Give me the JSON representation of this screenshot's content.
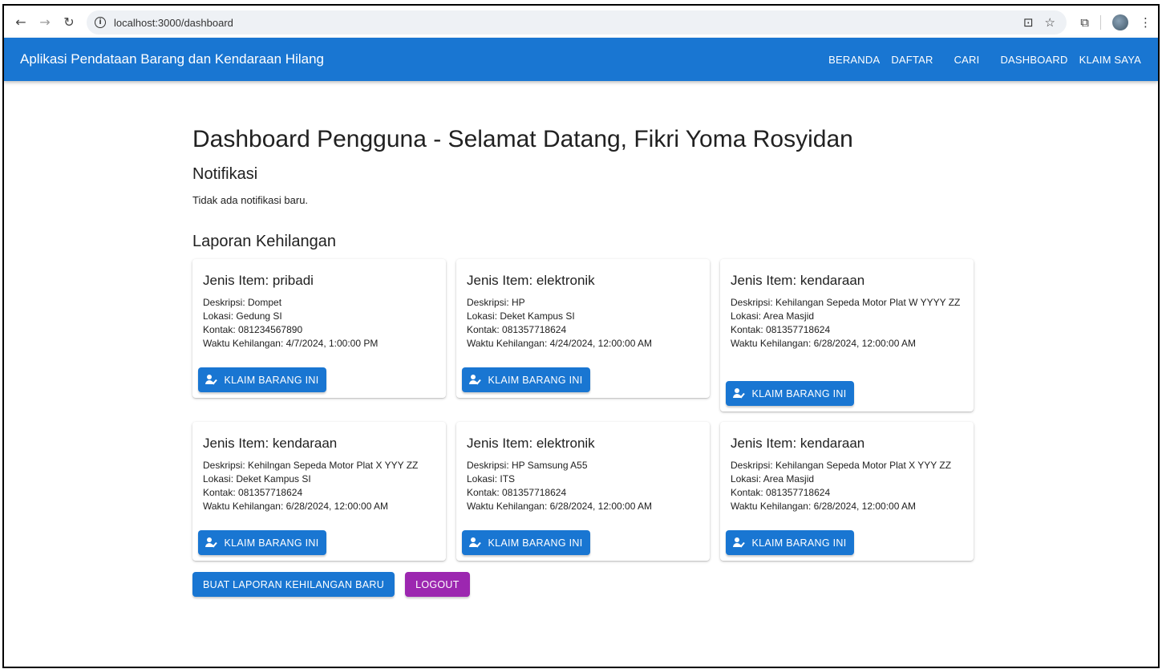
{
  "browser": {
    "url": "localhost:3000/dashboard",
    "back_icon": "←",
    "forward_icon": "→",
    "reload_icon": "↻",
    "info_icon": "i",
    "install_icon": "⊡",
    "star_icon": "☆",
    "extensions_icon": "⧉",
    "menu_icon": "⋮"
  },
  "appbar": {
    "title": "Aplikasi Pendataan Barang dan Kendaraan Hilang",
    "nav": [
      "BERANDA",
      "DAFTAR",
      "CARI",
      "DASHBOARD",
      "KLAIM SAYA"
    ],
    "color": "#1976d2"
  },
  "main": {
    "heading": "Dashboard Pengguna - Selamat Datang, Fikri Yoma Rosyidan",
    "notif_heading": "Notifikasi",
    "notif_text": "Tidak ada notifikasi baru.",
    "reports_heading": "Laporan Kehilangan",
    "claim_label": "KLAIM BARANG INI",
    "reports": [
      {
        "title": "Jenis Item: pribadi",
        "desc": "Deskripsi: Dompet",
        "loc": "Lokasi: Gedung SI",
        "contact": "Kontak: 081234567890",
        "time": "Waktu Kehilangan: 4/7/2024, 1:00:00 PM"
      },
      {
        "title": "Jenis Item: elektronik",
        "desc": "Deskripsi: HP",
        "loc": "Lokasi: Deket Kampus SI",
        "contact": "Kontak: 081357718624",
        "time": "Waktu Kehilangan: 4/24/2024, 12:00:00 AM"
      },
      {
        "title": "Jenis Item: kendaraan",
        "desc": "Deskripsi: Kehilangan Sepeda Motor Plat W YYYY ZZ",
        "loc": "Lokasi: Area Masjid",
        "contact": "Kontak: 081357718624",
        "time": "Waktu Kehilangan: 6/28/2024, 12:00:00 AM"
      },
      {
        "title": "Jenis Item: kendaraan",
        "desc": "Deskripsi: Kehilngan Sepeda Motor Plat X YYY ZZ",
        "loc": "Lokasi: Deket Kampus SI",
        "contact": "Kontak: 081357718624",
        "time": "Waktu Kehilangan: 6/28/2024, 12:00:00 AM"
      },
      {
        "title": "Jenis Item: elektronik",
        "desc": "Deskripsi: HP Samsung A55",
        "loc": "Lokasi: ITS",
        "contact": "Kontak: 081357718624",
        "time": "Waktu Kehilangan: 6/28/2024, 12:00:00 AM"
      },
      {
        "title": "Jenis Item: kendaraan",
        "desc": "Deskripsi: Kehilangan Sepeda Motor Plat X YYY ZZ",
        "loc": "Lokasi: Area Masjid",
        "contact": "Kontak: 081357718624",
        "time": "Waktu Kehilangan: 6/28/2024, 12:00:00 AM"
      }
    ],
    "new_report_label": "BUAT LAPORAN KEHILANGAN BARU",
    "logout_label": "LOGOUT",
    "logout_color": "#9c27b0"
  }
}
